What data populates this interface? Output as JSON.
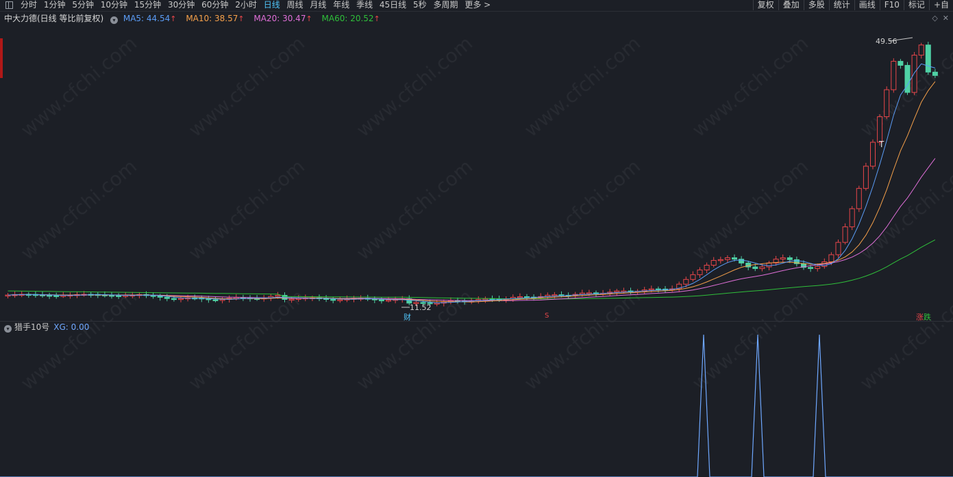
{
  "toolbar": {
    "periods": [
      "分时",
      "1分钟",
      "5分钟",
      "10分钟",
      "15分钟",
      "30分钟",
      "60分钟",
      "2小时",
      "日线",
      "周线",
      "月线",
      "年线",
      "季线",
      "45日线",
      "5秒",
      "多周期",
      "更多 >"
    ],
    "active_period": "日线",
    "right_buttons": [
      "复权",
      "叠加",
      "多股",
      "统计",
      "画线",
      "F10",
      "标记",
      "+自"
    ]
  },
  "main_chart": {
    "stock_name": "中大力德(日线 等比前复权)",
    "ma": [
      {
        "label": "MA5: 44.54",
        "color": "#5b9cf6"
      },
      {
        "label": "MA10: 38.57",
        "color": "#f5a04a"
      },
      {
        "label": "MA20: 30.47",
        "color": "#e06fd8"
      },
      {
        "label": "MA60: 20.52",
        "color": "#2fbf3a"
      }
    ],
    "high_label": "49.56",
    "low_label": "11.52",
    "marker_cai": "财",
    "marker_s": "S",
    "marker_t": "T",
    "zhang": "涨",
    "die": "跌"
  },
  "indicator": {
    "name": "猎手10号",
    "value_label": "XG: 0.00",
    "line_color": "#6fa8ff"
  },
  "colors": {
    "up": "#e8464a",
    "down": "#4fd1a5",
    "bg": "#1c1f26"
  },
  "watermark": "www.cfchi.com"
}
